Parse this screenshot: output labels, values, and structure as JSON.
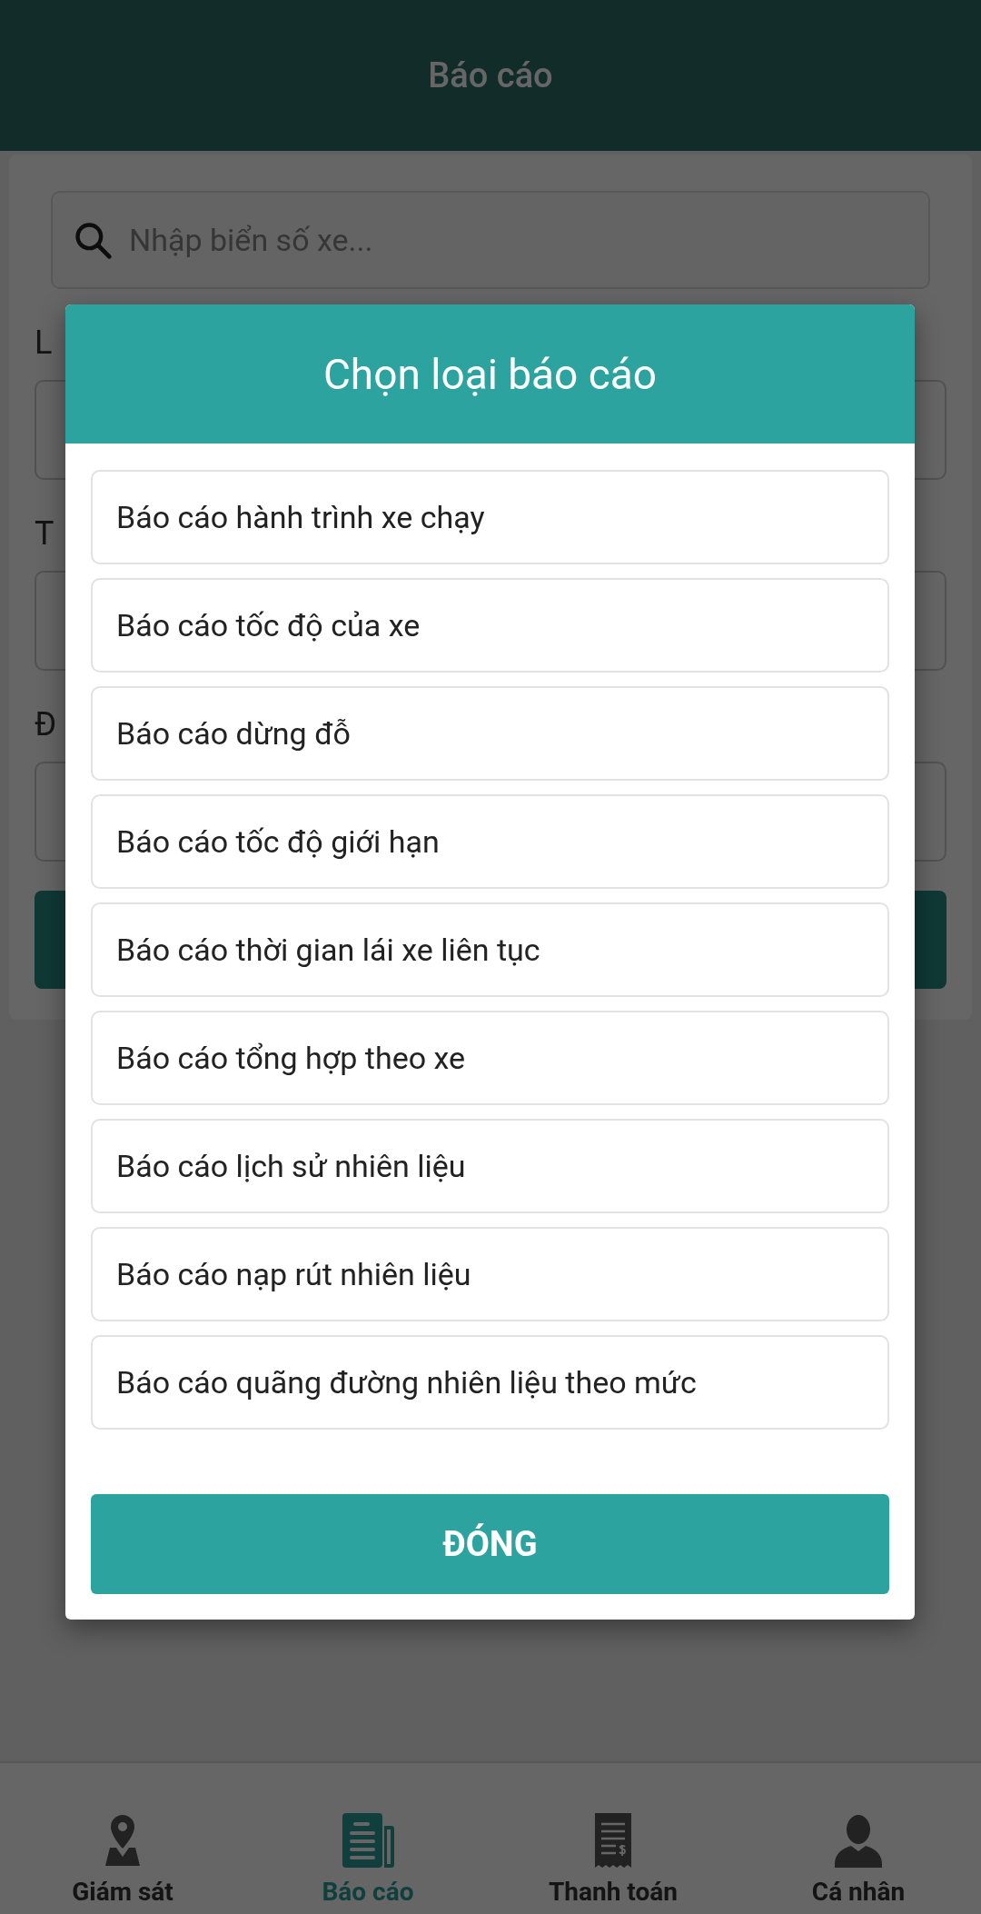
{
  "header": {
    "title": "Báo cáo"
  },
  "search": {
    "placeholder": "Nhập biển số xe..."
  },
  "form": {
    "fields": [
      {
        "label": "L"
      },
      {
        "label": "T"
      },
      {
        "label": "Đ"
      }
    ]
  },
  "bottom_nav": [
    {
      "label": "Giám sát",
      "kind": "pin",
      "selected": false
    },
    {
      "label": "Báo cáo",
      "kind": "news",
      "selected": true
    },
    {
      "label": "Thanh toán",
      "kind": "receipt",
      "selected": false
    },
    {
      "label": "Cá nhân",
      "kind": "person",
      "selected": false
    }
  ],
  "dialog": {
    "title": "Chọn loại báo cáo",
    "options": [
      "Báo cáo hành trình xe chạy",
      "Báo cáo tốc độ của xe",
      "Báo cáo dừng đỗ",
      "Báo cáo tốc độ giới hạn",
      "Báo cáo thời gian lái xe liên tục",
      "Báo cáo tổng hợp theo xe",
      "Báo cáo lịch sử nhiên liệu",
      "Báo cáo nạp rút nhiên liệu",
      "Báo cáo quãng đường nhiên liệu theo mức"
    ],
    "close_button": "ĐÓNG"
  }
}
